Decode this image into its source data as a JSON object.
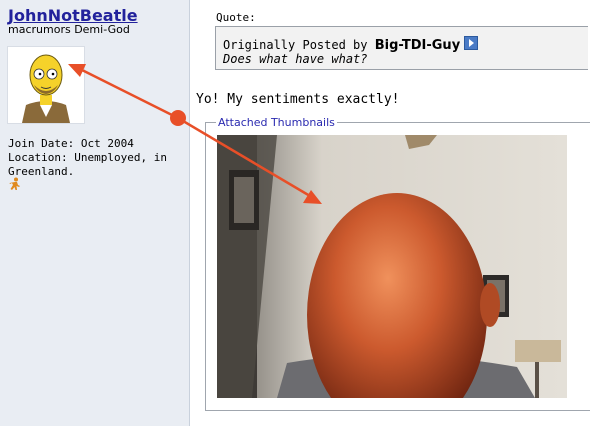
{
  "user": {
    "username": "JohnNotBeatle",
    "title": "macrumors Demi-God",
    "join_date": "Join Date: Oct 2004",
    "location": "Location: Unemployed, in Greenland."
  },
  "quote": {
    "label": "Quote:",
    "prefix": "Originally Posted by ",
    "author": "Big-TDI-Guy",
    "text": "Does what have what?"
  },
  "post": {
    "message": "Yo! My sentiments exactly!"
  },
  "attachments": {
    "legend": "Attached Thumbnails"
  },
  "colors": {
    "username": "#22229c",
    "sidebar_bg": "#e9edf3",
    "annotation_arrow": "#e84f28"
  },
  "icons": {
    "view_post": "view-post-icon",
    "status": "person-icon"
  }
}
